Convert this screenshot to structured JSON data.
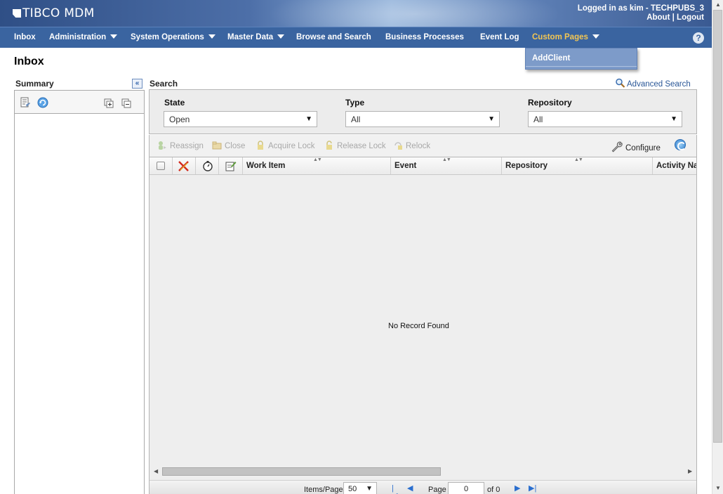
{
  "header": {
    "logo": "TIBCO MDM",
    "logged_in_as": "Logged in as  kim - TECHPUBS_3",
    "about": "About",
    "separator": "|",
    "logout": "Logout"
  },
  "nav": {
    "items": [
      {
        "label": "Inbox",
        "has_caret": false
      },
      {
        "label": "Administration",
        "has_caret": true
      },
      {
        "label": "System Operations",
        "has_caret": true
      },
      {
        "label": "Master Data",
        "has_caret": true
      },
      {
        "label": "Browse and Search",
        "has_caret": false
      },
      {
        "label": "Business Processes",
        "has_caret": false
      },
      {
        "label": "Event Log",
        "has_caret": false
      },
      {
        "label": "Custom Pages",
        "has_caret": true,
        "active": true
      }
    ],
    "dropdown_option": "AddClient",
    "help_icon": "?"
  },
  "page": {
    "title": "Inbox"
  },
  "summary": {
    "label": "Summary",
    "collapse_icon": "«"
  },
  "search": {
    "label": "Search",
    "advanced": "Advanced Search",
    "state_label": "State",
    "state_value": "Open",
    "type_label": "Type",
    "type_value": "All",
    "repo_label": "Repository",
    "repo_value": "All",
    "dropdown_arrow": "▼"
  },
  "toolbar": {
    "reassign": "Reassign",
    "close": "Close",
    "acquire_lock": "Acquire Lock",
    "release_lock": "Release Lock",
    "relock": "Relock",
    "configure": "Configure"
  },
  "grid": {
    "columns": [
      "Work Item",
      "Event",
      "Repository",
      "Activity Na"
    ],
    "sort_glyph": "▲▼",
    "empty": "No Record Found"
  },
  "pager": {
    "items_per_page_label": "Items/Page",
    "items_per_page": "50",
    "page_label": "Page",
    "page": "0",
    "of_label": "of 0",
    "arrow_down": "▼"
  },
  "colors": {
    "nav_bg": "#3a64a0",
    "active_nav": "#f3c653",
    "link": "#2a5797"
  }
}
